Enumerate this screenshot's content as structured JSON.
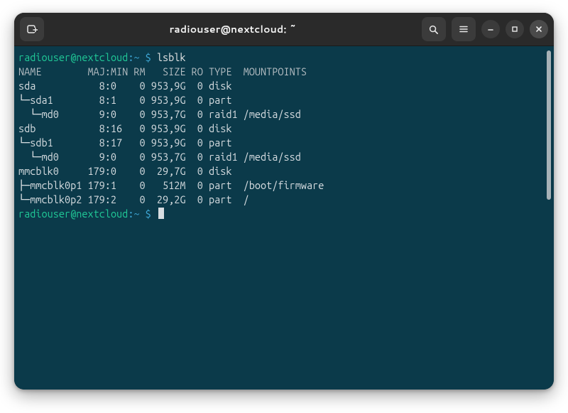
{
  "window": {
    "title": "radiouser@nextcloud: ~"
  },
  "prompt": {
    "user": "radiouser",
    "at": "@",
    "host": "nextcloud",
    "colon": ":",
    "path": "~",
    "dollar": " $ "
  },
  "commands": {
    "lsblk": "lsblk"
  },
  "header": "NAME        MAJ:MIN RM   SIZE RO TYPE  MOUNTPOINTS",
  "rows": [
    "sda           8:0    0 953,9G  0 disk",
    "└─sda1        8:1    0 953,9G  0 part",
    "  └─md0       9:0    0 953,7G  0 raid1 /media/ssd",
    "sdb           8:16   0 953,9G  0 disk",
    "└─sdb1        8:17   0 953,9G  0 part",
    "  └─md0       9:0    0 953,7G  0 raid1 /media/ssd",
    "mmcblk0     179:0    0  29,7G  0 disk",
    "├─mmcblk0p1 179:1    0   512M  0 part  /boot/firmware",
    "└─mmcblk0p2 179:2    0  29,2G  0 part  /"
  ]
}
